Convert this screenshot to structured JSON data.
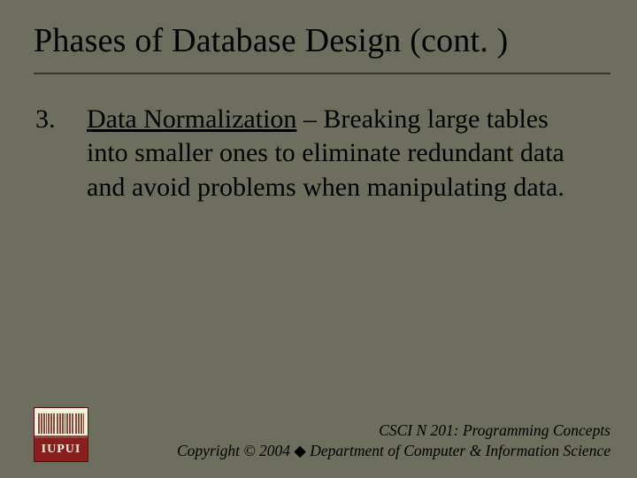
{
  "title": "Phases of Database Design (cont. )",
  "list": {
    "number": "3.",
    "term": "Data Normalization",
    "rest": " – Breaking large tables into smaller ones to eliminate redundant data and avoid problems when manipulating data."
  },
  "footer": {
    "course": "CSCI N 201: Programming Concepts",
    "copyright_prefix": "Copyright © 2004 ",
    "bullet": "◆",
    "copyright_suffix": " Department of Computer & Information Science"
  },
  "logo": {
    "text": "IUPUI"
  }
}
